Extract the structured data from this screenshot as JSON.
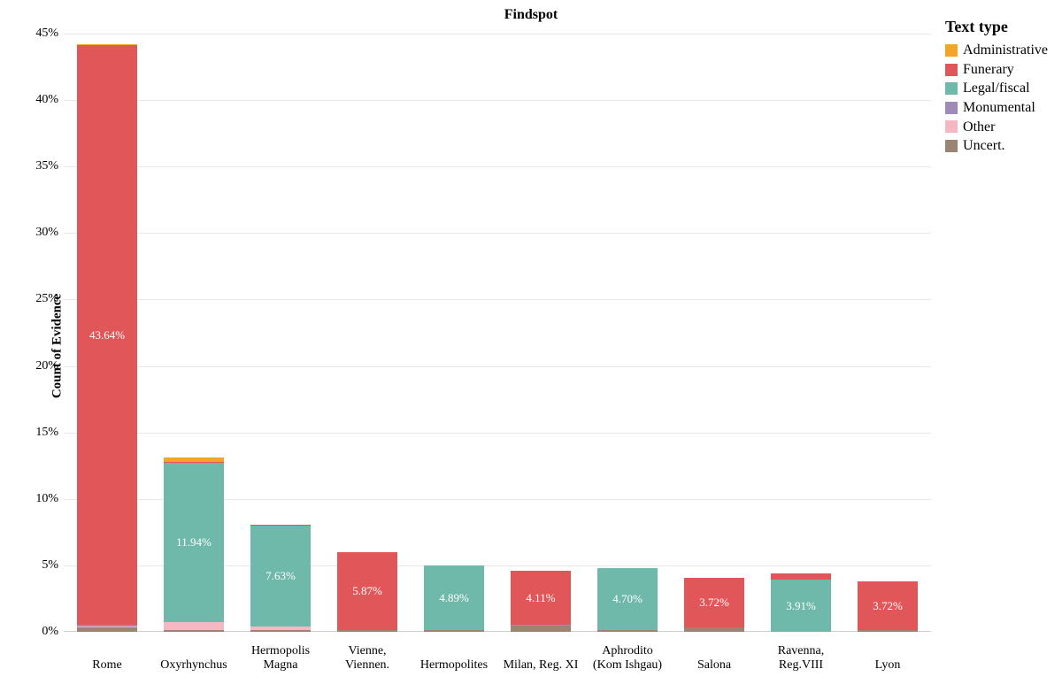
{
  "title": "Findspot",
  "ylabel": "Count of Evidence",
  "legend": {
    "title": "Text type",
    "items": [
      {
        "name": "Administrative",
        "color": "#f4a529"
      },
      {
        "name": "Funerary",
        "color": "#e15759"
      },
      {
        "name": "Legal/fiscal",
        "color": "#6fb9aa"
      },
      {
        "name": "Monumental",
        "color": "#9f8bb5"
      },
      {
        "name": "Other",
        "color": "#f5b7c2"
      },
      {
        "name": "Uncert.",
        "color": "#9b8572"
      }
    ]
  },
  "chart_data": {
    "type": "bar-stacked",
    "ylim": [
      0,
      45
    ],
    "yticks": [
      0,
      5,
      10,
      15,
      20,
      25,
      30,
      35,
      40,
      45
    ],
    "ytick_fmt": "pct",
    "series_order": [
      "Uncert.",
      "Other",
      "Monumental",
      "Legal/fiscal",
      "Funerary",
      "Administrative"
    ],
    "colors": {
      "Administrative": "#f4a529",
      "Funerary": "#e15759",
      "Legal/fiscal": "#6fb9aa",
      "Monumental": "#9f8bb5",
      "Other": "#f5b7c2",
      "Uncert.": "#9b8572"
    },
    "categories": [
      {
        "label": "Rome",
        "stacks": {
          "Uncert.": 0.35,
          "Other": 0.05,
          "Monumental": 0.1,
          "Legal/fiscal": 0.0,
          "Funerary": 43.64,
          "Administrative": 0.05
        },
        "data_label": "43.64%",
        "label_series": "Funerary"
      },
      {
        "label": "Oxyrhynchus",
        "stacks": {
          "Uncert.": 0.15,
          "Other": 0.6,
          "Monumental": 0.0,
          "Legal/fiscal": 11.94,
          "Funerary": 0.1,
          "Administrative": 0.3
        },
        "data_label": "11.94%",
        "label_series": "Legal/fiscal"
      },
      {
        "label": "Hermopolis\nMagna",
        "stacks": {
          "Uncert.": 0.1,
          "Other": 0.3,
          "Monumental": 0.0,
          "Legal/fiscal": 7.63,
          "Funerary": 0.05,
          "Administrative": 0.0
        },
        "data_label": "7.63%",
        "label_series": "Legal/fiscal"
      },
      {
        "label": "Vienne,\nViennen.",
        "stacks": {
          "Uncert.": 0.1,
          "Other": 0.0,
          "Monumental": 0.0,
          "Legal/fiscal": 0.0,
          "Funerary": 5.87,
          "Administrative": 0.0
        },
        "data_label": "5.87%",
        "label_series": "Funerary"
      },
      {
        "label": "Hermopolites",
        "stacks": {
          "Uncert.": 0.1,
          "Other": 0.0,
          "Monumental": 0.0,
          "Legal/fiscal": 4.89,
          "Funerary": 0.0,
          "Administrative": 0.0
        },
        "data_label": "4.89%",
        "label_series": "Legal/fiscal"
      },
      {
        "label": "Milan, Reg. XI",
        "stacks": {
          "Uncert.": 0.45,
          "Other": 0.0,
          "Monumental": 0.05,
          "Legal/fiscal": 0.0,
          "Funerary": 4.11,
          "Administrative": 0.0
        },
        "data_label": "4.11%",
        "label_series": "Funerary"
      },
      {
        "label": "Aphrodito\n(Kom Ishgau)",
        "stacks": {
          "Uncert.": 0.1,
          "Other": 0.0,
          "Monumental": 0.0,
          "Legal/fiscal": 4.7,
          "Funerary": 0.0,
          "Administrative": 0.0
        },
        "data_label": "4.70%",
        "label_series": "Legal/fiscal"
      },
      {
        "label": "Salona",
        "stacks": {
          "Uncert.": 0.35,
          "Other": 0.0,
          "Monumental": 0.0,
          "Legal/fiscal": 0.0,
          "Funerary": 3.72,
          "Administrative": 0.0
        },
        "data_label": "3.72%",
        "label_series": "Funerary"
      },
      {
        "label": "Ravenna,\nReg.VIII",
        "stacks": {
          "Uncert.": 0.0,
          "Other": 0.0,
          "Monumental": 0.0,
          "Legal/fiscal": 3.91,
          "Funerary": 0.5,
          "Administrative": 0.0
        },
        "data_label": "3.91%",
        "label_series": "Legal/fiscal"
      },
      {
        "label": "Lyon",
        "stacks": {
          "Uncert.": 0.1,
          "Other": 0.0,
          "Monumental": 0.0,
          "Legal/fiscal": 0.0,
          "Funerary": 3.72,
          "Administrative": 0.0
        },
        "data_label": "3.72%",
        "label_series": "Funerary"
      }
    ]
  }
}
